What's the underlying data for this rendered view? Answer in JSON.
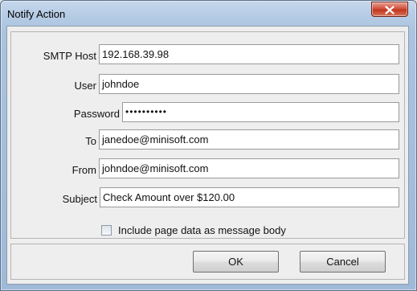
{
  "window": {
    "title": "Notify Action",
    "close_icon": "close-x-icon"
  },
  "form": {
    "fields": [
      {
        "key": "smtp_host",
        "label": "SMTP Host",
        "value": "192.168.39.98"
      },
      {
        "key": "user",
        "label": "User",
        "value": "johndoe"
      },
      {
        "key": "password",
        "label": "Password",
        "value": "••••••••••"
      },
      {
        "key": "to",
        "label": "To",
        "value": "janedoe@minisoft.com"
      },
      {
        "key": "from",
        "label": "From",
        "value": "johndoe@minisoft.com"
      },
      {
        "key": "subject",
        "label": "Subject",
        "value": "Check Amount over $120.00"
      }
    ],
    "checkbox": {
      "label": "Include page data as message body",
      "checked": false
    }
  },
  "buttons": {
    "ok": {
      "mnemonic": "O",
      "rest": "K"
    },
    "cancel": {
      "mnemonic": "C",
      "rest": "ancel"
    }
  },
  "colors": {
    "title_bar": "#b5cbe4",
    "close_button": "#c2361f",
    "client_bg": "#eeeeee"
  }
}
